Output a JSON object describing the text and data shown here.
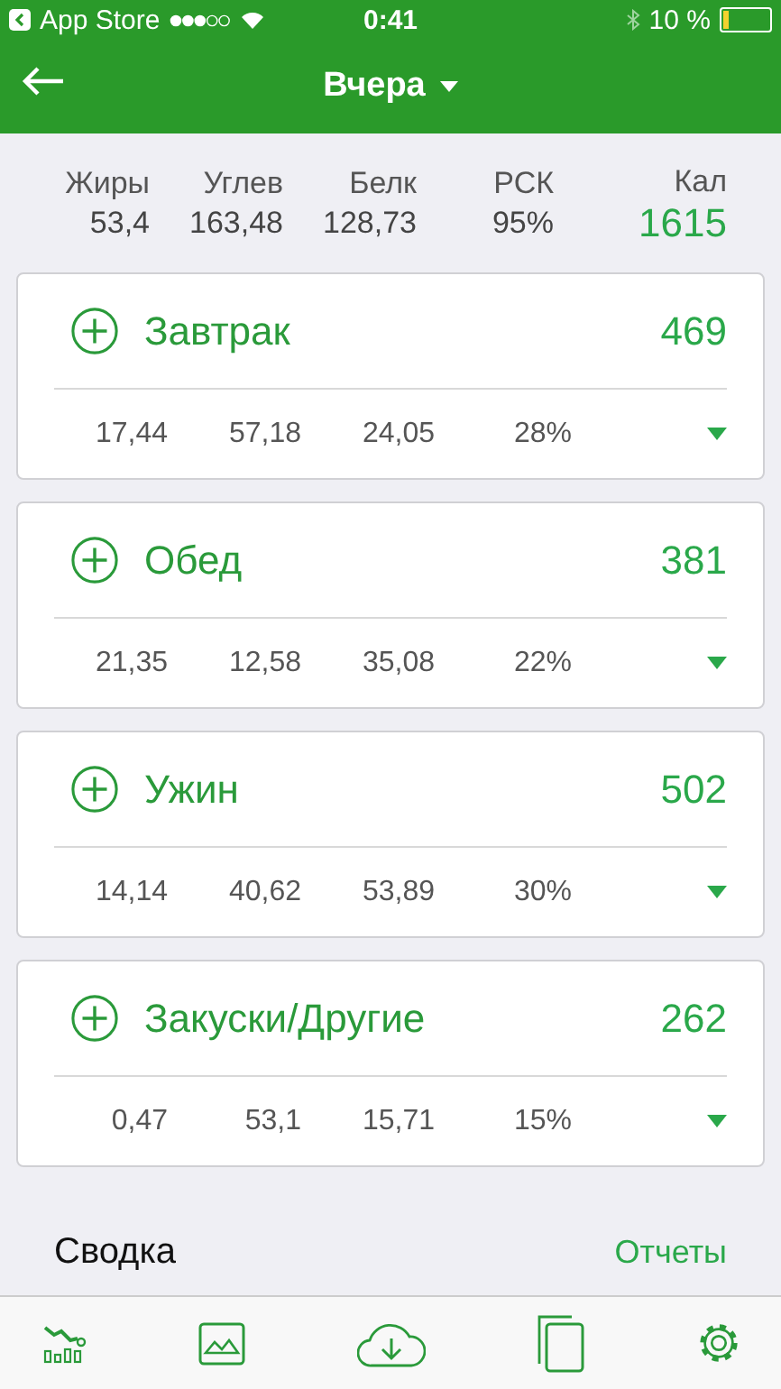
{
  "status_bar": {
    "back_app": "App Store",
    "time": "0:41",
    "battery": "10 %"
  },
  "nav": {
    "title": "Вчера"
  },
  "summary": {
    "columns": [
      {
        "label": "Жиры",
        "value": "53,4"
      },
      {
        "label": "Углев",
        "value": "163,48"
      },
      {
        "label": "Белк",
        "value": "128,73"
      },
      {
        "label": "РСК",
        "value": "95%"
      }
    ],
    "calories": {
      "label": "Кал",
      "value": "1615"
    }
  },
  "meals": [
    {
      "name": "Завтрак",
      "calories": "469",
      "values": [
        "17,44",
        "57,18",
        "24,05",
        "28%"
      ],
      "expanded": false
    },
    {
      "name": "Обед",
      "calories": "381",
      "values": [
        "21,35",
        "12,58",
        "35,08",
        "22%"
      ],
      "expanded": false
    },
    {
      "name": "Ужин",
      "calories": "502",
      "values": [
        "14,14",
        "40,62",
        "53,89",
        "30%"
      ],
      "expanded": false
    },
    {
      "name": "Закуски/Другие",
      "calories": "262",
      "values": [
        "0,47",
        "53,1",
        "15,71",
        "15%"
      ],
      "expanded": false
    }
  ],
  "section": {
    "title": "Сводка",
    "link": "Отчеты"
  },
  "tab_bar": [
    {
      "kind": "chart"
    },
    {
      "kind": "image"
    },
    {
      "kind": "download"
    },
    {
      "kind": "copy"
    },
    {
      "kind": "settings"
    }
  ]
}
